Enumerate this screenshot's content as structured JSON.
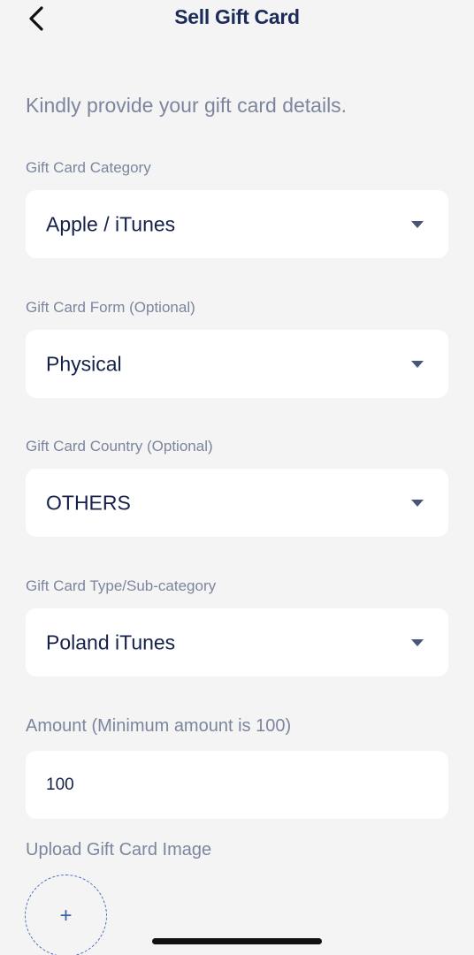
{
  "header": {
    "title": "Sell Gift Card"
  },
  "intro": "Kindly provide your gift card details.",
  "fields": {
    "category": {
      "label": "Gift Card Category",
      "value": "Apple / iTunes"
    },
    "form": {
      "label": "Gift Card Form (Optional)",
      "value": "Physical"
    },
    "country": {
      "label": "Gift Card Country (Optional)",
      "value": "OTHERS"
    },
    "type": {
      "label": "Gift Card Type/Sub-category",
      "value": "Poland iTunes"
    },
    "amount": {
      "label": "Amount (Minimum amount is 100)",
      "value": "100"
    }
  },
  "upload": {
    "label": "Upload Gift Card Image",
    "icon": "plus-icon",
    "glyph": "+"
  },
  "colors": {
    "title": "#1c2b5a",
    "label": "#7b869e",
    "value": "#16214a",
    "background": "#f4f4f4",
    "field": "#ffffff",
    "upload_border": "#4a6fc0"
  }
}
